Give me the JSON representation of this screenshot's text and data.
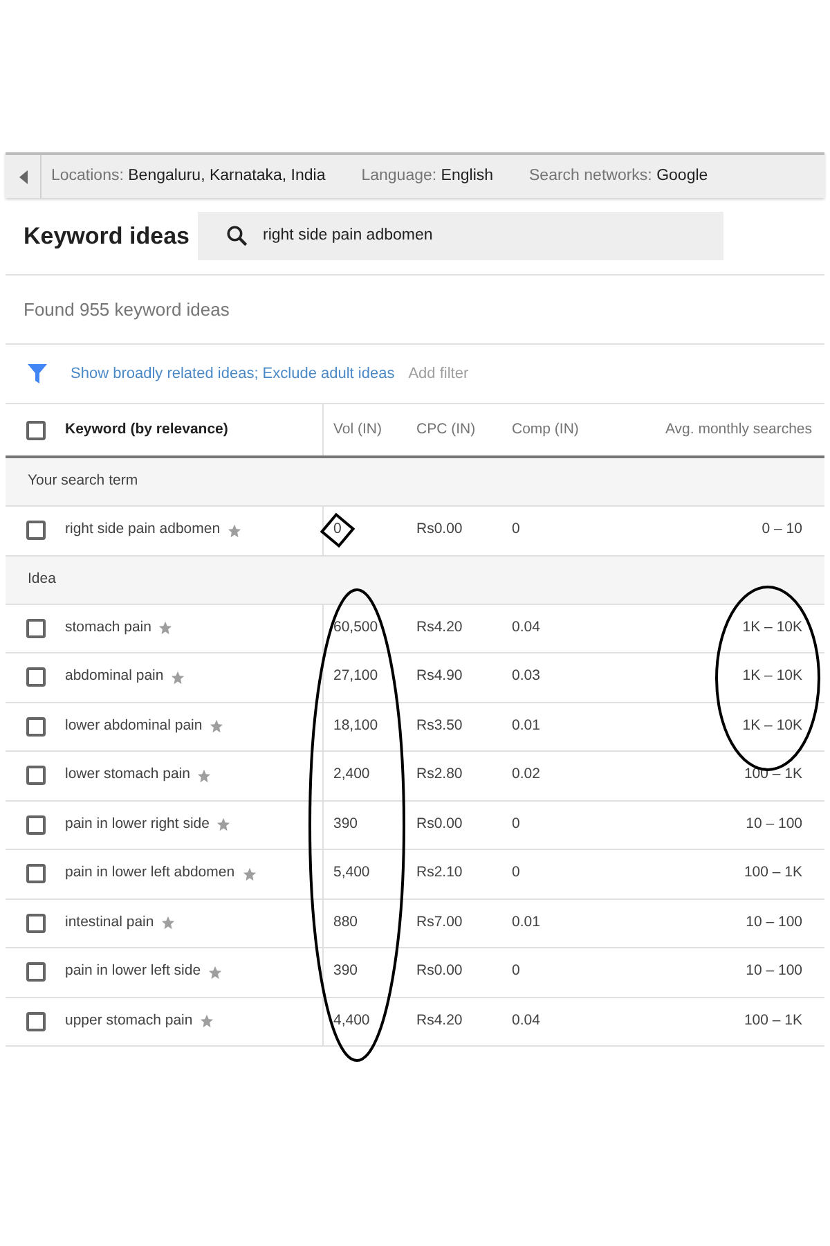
{
  "settings_bar": [
    {
      "label": "Locations:",
      "value": "Bengaluru, Karnataka, India"
    },
    {
      "label": "Language:",
      "value": "English"
    },
    {
      "label": "Search networks:",
      "value": "Google"
    }
  ],
  "title": "Keyword ideas",
  "search": {
    "value": "right side pain adbomen"
  },
  "found": "Found 955 keyword ideas",
  "filters": {
    "active": "Show broadly related ideas; Exclude adult ideas",
    "add": "Add filter"
  },
  "table": {
    "columns": [
      "Keyword (by relevance)",
      "Vol (IN)",
      "CPC (IN)",
      "Comp (IN)",
      "Avg. monthly searches"
    ],
    "header_checked": false,
    "groups": [
      {
        "title": "Your search term",
        "rows": [
          {
            "keyword": "right side pain adbomen",
            "checked": false,
            "cells": [
              "0",
              "Rs0.00",
              "0",
              "0 – 10"
            ]
          }
        ]
      },
      {
        "title": "Idea",
        "rows": [
          {
            "keyword": "stomach pain",
            "checked": false,
            "cells": [
              "60,500",
              "Rs4.20",
              "0.04",
              "1K – 10K"
            ]
          },
          {
            "keyword": "abdominal pain",
            "checked": false,
            "cells": [
              "27,100",
              "Rs4.90",
              "0.03",
              "1K – 10K"
            ]
          },
          {
            "keyword": "lower abdominal pain",
            "checked": false,
            "cells": [
              "18,100",
              "Rs3.50",
              "0.01",
              "1K – 10K"
            ]
          },
          {
            "keyword": "lower stomach pain",
            "checked": false,
            "cells": [
              "2,400",
              "Rs2.80",
              "0.02",
              "100 – 1K"
            ]
          },
          {
            "keyword": "pain in lower right side",
            "checked": false,
            "cells": [
              "390",
              "Rs0.00",
              "0",
              "10 – 100"
            ]
          },
          {
            "keyword": "pain in lower left abdomen",
            "checked": false,
            "cells": [
              "5,400",
              "Rs2.10",
              "0",
              "100 – 1K"
            ]
          },
          {
            "keyword": "intestinal pain",
            "checked": false,
            "cells": [
              "880",
              "Rs7.00",
              "0.01",
              "10 – 100"
            ]
          },
          {
            "keyword": "pain in lower left side",
            "checked": false,
            "cells": [
              "390",
              "Rs0.00",
              "0",
              "10 – 100"
            ]
          },
          {
            "keyword": "upper stomach pain",
            "checked": false,
            "cells": [
              "4,400",
              "Rs4.20",
              "0.04",
              "100 – 1K"
            ]
          }
        ]
      }
    ]
  },
  "annotations": [
    {
      "kind": "diamond"
    },
    {
      "kind": "volume-ellipse"
    },
    {
      "kind": "searches-ellipse"
    }
  ]
}
